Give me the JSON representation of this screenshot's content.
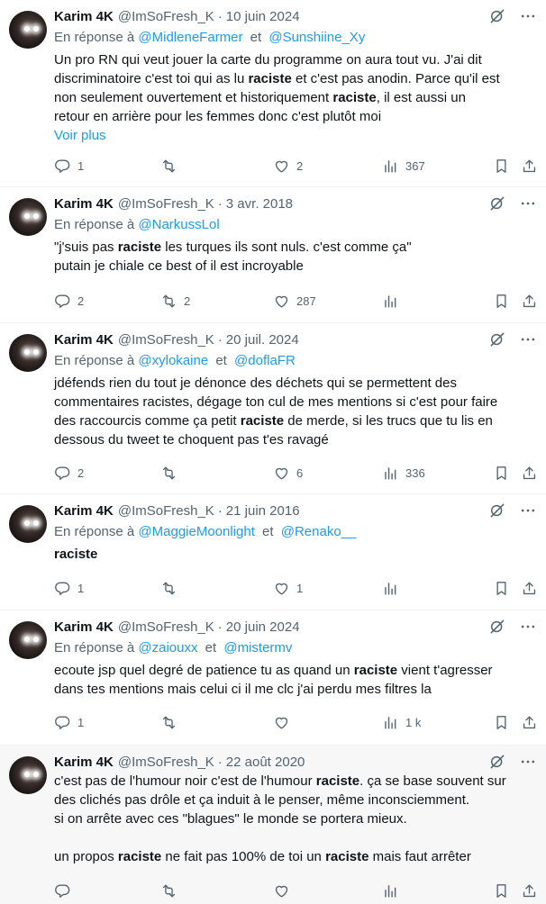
{
  "tweets": [
    {
      "name": "Karim 4K",
      "handle": "@ImSoFresh_K",
      "date": "10 juin 2024",
      "reply_prefix": "En réponse à",
      "reply_to": [
        "@MidleneFarmer",
        "@Sunshiine_Xy"
      ],
      "reply_sep": "et",
      "lines": [
        [
          {
            "t": "Un pro RN qui veut jouer la carte du programme on aura tout vu. J'ai dit"
          }
        ],
        [
          {
            "t": "discriminatoire c'est toi qui as lu "
          },
          {
            "t": "raciste",
            "b": true
          },
          {
            "t": " et c'est pas anodin. Parce qu'il est"
          }
        ],
        [
          {
            "t": "non seulement ouvertement et historiquement "
          },
          {
            "t": "raciste",
            "b": true
          },
          {
            "t": ", il est aussi un"
          }
        ],
        [
          {
            "t": "retour en arrière pour les femmes donc c'est plutôt moi"
          }
        ]
      ],
      "voir_plus": "Voir plus",
      "replies": "1",
      "retweets": "",
      "likes": "2",
      "views": "367"
    },
    {
      "name": "Karim 4K",
      "handle": "@ImSoFresh_K",
      "date": "3 avr. 2018",
      "reply_prefix": "En réponse à",
      "reply_to": [
        "@NarkussLol"
      ],
      "reply_sep": "et",
      "lines": [
        [
          {
            "t": "\"j'suis pas "
          },
          {
            "t": "raciste",
            "b": true
          },
          {
            "t": " les turques ils sont nuls. c'est comme ça\""
          }
        ],
        [
          {
            "t": "putain je chiale ce best of il est incroyable"
          }
        ]
      ],
      "replies": "2",
      "retweets": "2",
      "likes": "287",
      "views": ""
    },
    {
      "name": "Karim 4K",
      "handle": "@ImSoFresh_K",
      "date": "20 juil. 2024",
      "reply_prefix": "En réponse à",
      "reply_to": [
        "@xylokaine",
        "@doflaFR"
      ],
      "reply_sep": "et",
      "lines": [
        [
          {
            "t": "jdéfends rien du tout je dénonce des déchets qui se permettent des"
          }
        ],
        [
          {
            "t": "commentaires racistes, dégage ton cul de mes mentions si c'est pour faire"
          }
        ],
        [
          {
            "t": "des raccourcis comme ça petit "
          },
          {
            "t": "raciste",
            "b": true
          },
          {
            "t": " de merde, si les trucs que tu lis en"
          }
        ],
        [
          {
            "t": "dessous du tweet te choquent pas t'es ravagé"
          }
        ]
      ],
      "replies": "2",
      "retweets": "",
      "likes": "6",
      "views": "336"
    },
    {
      "name": "Karim 4K",
      "handle": "@ImSoFresh_K",
      "date": "21 juin 2016",
      "reply_prefix": "En réponse à",
      "reply_to": [
        "@MaggieMoonlight",
        "@Renako__"
      ],
      "reply_sep": "et",
      "lines": [
        [
          {
            "t": "raciste",
            "b": true
          }
        ]
      ],
      "replies": "1",
      "retweets": "",
      "likes": "1",
      "views": ""
    },
    {
      "name": "Karim 4K",
      "handle": "@ImSoFresh_K",
      "date": "20 juin 2024",
      "reply_prefix": "En réponse à",
      "reply_to": [
        "@zaiouxx",
        "@mistermv"
      ],
      "reply_sep": "et",
      "lines": [
        [
          {
            "t": "ecoute jsp quel degré de patience tu as quand un "
          },
          {
            "t": "raciste",
            "b": true
          },
          {
            "t": " vient t'agresser"
          }
        ],
        [
          {
            "t": "dans tes mentions mais celui ci il me clc j'ai perdu mes filtres la"
          }
        ]
      ],
      "replies": "1",
      "retweets": "",
      "likes": "",
      "views": "1 k"
    },
    {
      "name": "Karim 4K",
      "handle": "@ImSoFresh_K",
      "date": "22 août 2020",
      "reply_prefix": "",
      "reply_to": [],
      "reply_sep": "",
      "lines": [
        [
          {
            "t": "c'est pas de l'humour noir c'est de l'humour "
          },
          {
            "t": "raciste",
            "b": true
          },
          {
            "t": ". ça se base souvent sur"
          }
        ],
        [
          {
            "t": "des clichés pas drôle et ça induit à le penser, même inconsciemment."
          }
        ],
        [
          {
            "t": "si on arrête avec ces \"blagues\" le monde se portera mieux."
          }
        ],
        [],
        [
          {
            "t": "un propos "
          },
          {
            "t": "raciste",
            "b": true
          },
          {
            "t": " ne fait pas 100% de toi un "
          },
          {
            "t": "raciste",
            "b": true
          },
          {
            "t": " mais faut arrêter"
          }
        ]
      ],
      "replies": "",
      "retweets": "",
      "likes": "",
      "views": ""
    }
  ],
  "icons": {
    "reply": "reply-icon",
    "retweet": "retweet-icon",
    "like": "heart-icon",
    "views": "views-icon",
    "bookmark": "bookmark-icon",
    "share": "share-icon",
    "grok": "grok-icon",
    "more": "more-icon"
  },
  "colors": {
    "text": "#0f1419",
    "secondary": "#536471",
    "link": "#1d9bf0"
  }
}
